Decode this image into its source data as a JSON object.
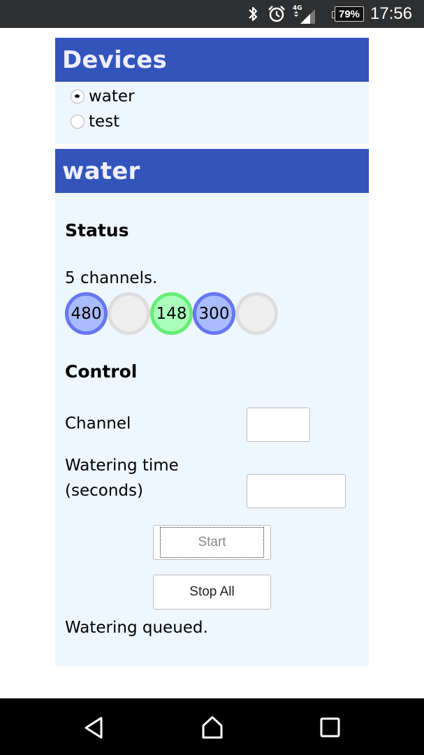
{
  "status_bar": {
    "icons": [
      "bluetooth-icon",
      "alarm-icon",
      "signal-4g-icon"
    ],
    "network_label": "4G",
    "battery": "79%",
    "time": "17:56"
  },
  "devices": {
    "title": "Devices",
    "options": [
      {
        "label": "water",
        "checked": true
      },
      {
        "label": "test",
        "checked": false
      }
    ]
  },
  "device": {
    "title": "water",
    "status": {
      "heading": "Status",
      "channels_text": "5 channels.",
      "channels": [
        {
          "value": "480",
          "state": "on"
        },
        {
          "value": "",
          "state": "off"
        },
        {
          "value": "148",
          "state": "active"
        },
        {
          "value": "300",
          "state": "on"
        },
        {
          "value": "",
          "state": "off"
        }
      ],
      "colors": {
        "on_border": "#6677ee",
        "on_fill": "#aabbff",
        "active_border": "#66ee77",
        "active_fill": "#aaffbb",
        "off_border": "#dddddd",
        "off_fill": "#eeeeee"
      }
    },
    "control": {
      "heading": "Control",
      "channel_label": "Channel",
      "channel_value": "",
      "time_label_line1": "Watering time",
      "time_label_line2": "(seconds)",
      "time_value": "",
      "start_label": "Start",
      "stop_label": "Stop All",
      "message": "Watering queued."
    }
  },
  "theme": {
    "header_bg": "#3355bb",
    "header_text": "#eeeeff",
    "card_bg": "#eef6ff"
  },
  "nav_bar": {
    "buttons": [
      "back-icon",
      "home-icon",
      "recent-apps-icon"
    ]
  }
}
